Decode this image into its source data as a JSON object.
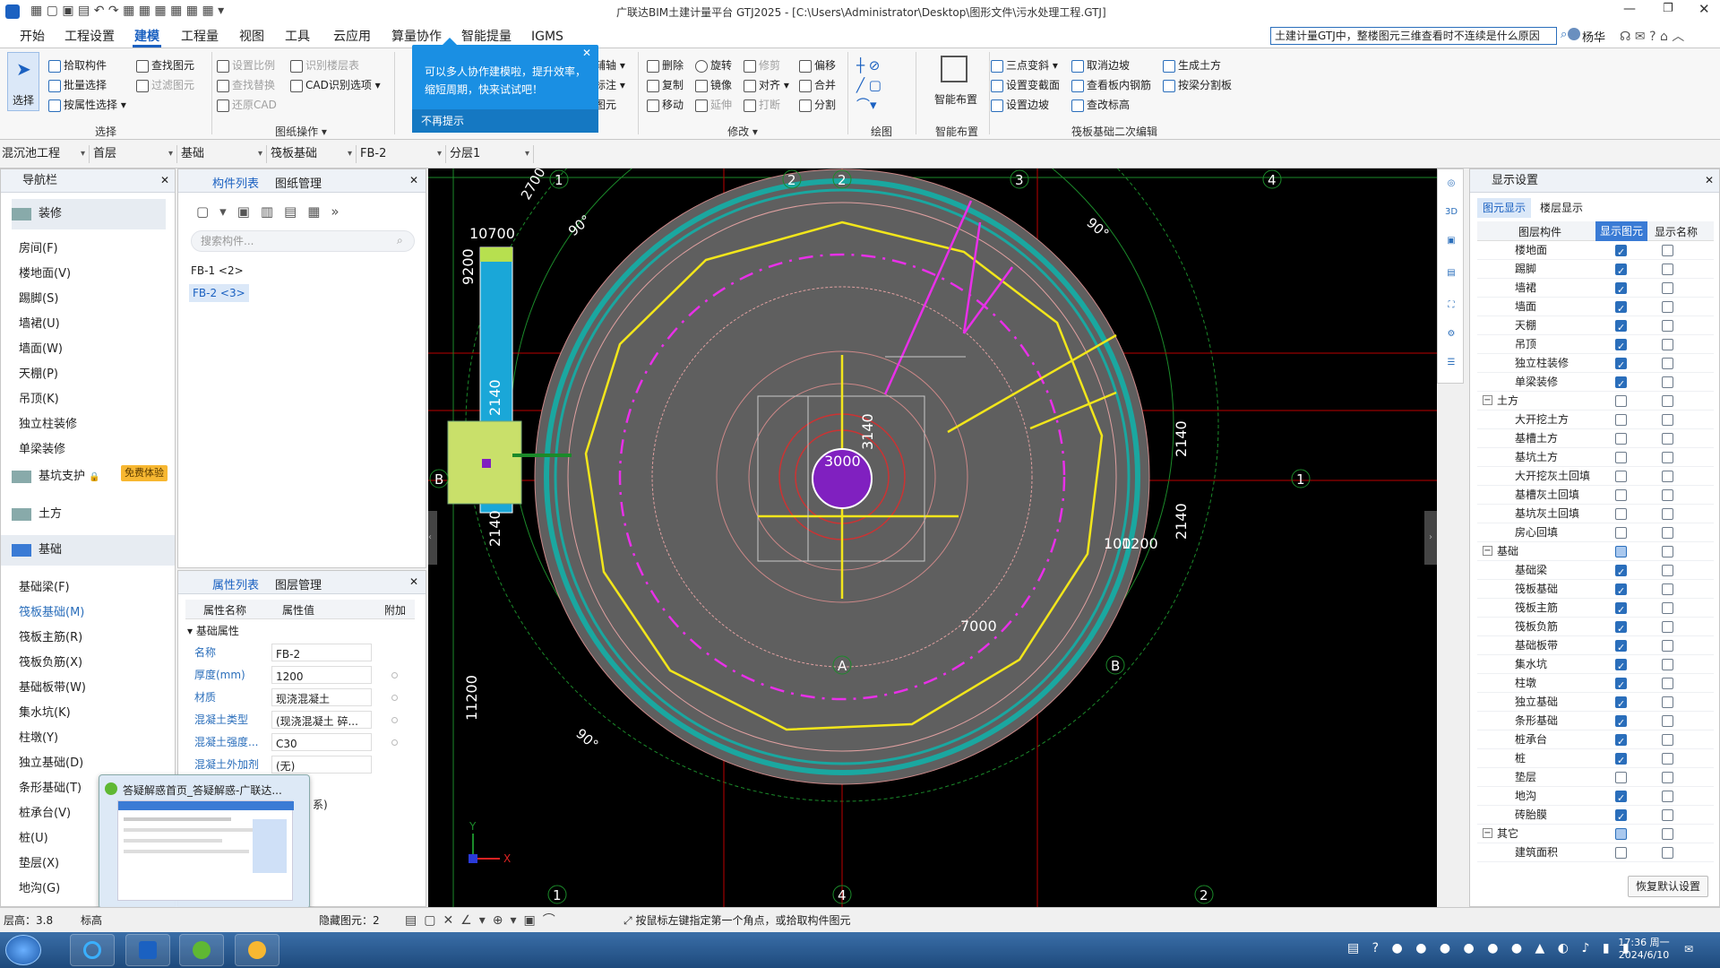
{
  "title": "广联达BIM土建计量平台 GTJ2025 - [C:\\Users\\Administrator\\Desktop\\图形文件\\污水处理工程.GTJ]",
  "menu_tabs": [
    "开始",
    "工程设置",
    "建模",
    "工程量",
    "视图",
    "工具",
    "云应用",
    "算量协作",
    "智能提量",
    "IGMS"
  ],
  "search": {
    "value": "土建计量GTJ中，整楼图元三维查看时不连续是什么原因"
  },
  "user": "杨华",
  "ribbon": {
    "select": {
      "big": "选择",
      "pick": "拾取构件",
      "batch": "批量选择",
      "byattr": "按属性选择",
      "group": "选择"
    },
    "cad": {
      "find": "查找图元",
      "filter": "过滤图元",
      "setscale": "设置比例",
      "findreplace": "查找替换",
      "restore": "还原CAD",
      "recfloor": "识别楼层表",
      "cadopt": "CAD识别选项",
      "group": "图纸操作"
    },
    "modify": {
      "delete": "删除",
      "rotate": "旋转",
      "trim": "修剪",
      "offset": "偏移",
      "copy": "复制",
      "mirror": "镜像",
      "align": "对齐",
      "merge": "合并",
      "move": "移动",
      "extend": "延伸",
      "break": "打断",
      "split": "分割",
      "group": "修改",
      "aux": "辅轴",
      "note": "标注",
      "elem": "图元"
    },
    "draw": {
      "group": "绘图"
    },
    "smart": {
      "big": "智能布置",
      "group": "智能布置"
    },
    "fb": {
      "threeslope": "三点变斜",
      "cancelslope": "取消边坡",
      "genearth": "生成土方",
      "setsection": "设置变截面",
      "viewrebar": "查看板内钢筋",
      "splitbyline": "按梁分割板",
      "setslope": "设置边坡",
      "viewheight": "查改标高",
      "group": "筏板基础二次编辑"
    }
  },
  "tooltip": {
    "text": "可以多人协作建模啦，提升效率，缩短周期，快来试试吧！",
    "dismiss": "不再提示"
  },
  "selectors": [
    "混沉池工程",
    "首层",
    "基础",
    "筏板基础",
    "FB-2",
    "分层1"
  ],
  "nav": {
    "title": "导航栏",
    "cat_decor": "装修",
    "items_decor": [
      "房间(F)",
      "楼地面(V)",
      "踢脚(S)",
      "墙裙(U)",
      "墙面(W)",
      "天棚(P)",
      "吊顶(K)",
      "独立柱装修",
      "单梁装修"
    ],
    "cat_pit": "基坑支护",
    "badge": "免费体验",
    "cat_earth": "土方",
    "cat_found": "基础",
    "items_found": [
      "基础梁(F)",
      "筏板基础(M)",
      "筏板主筋(R)",
      "筏板负筋(X)",
      "基础板带(W)",
      "集水坑(K)",
      "柱墩(Y)",
      "独立基础(D)",
      "条形基础(T)",
      "桩承台(V)",
      "桩(U)",
      "垫层(X)",
      "地沟(G)"
    ]
  },
  "complist": {
    "tab1": "构件列表",
    "tab2": "图纸管理",
    "search_ph": "搜索构件...",
    "items": [
      "FB-1 <2>",
      "FB-2 <3>"
    ]
  },
  "props": {
    "tab1": "属性列表",
    "tab2": "图层管理",
    "col_name": "属性名称",
    "col_value": "属性值",
    "col_add": "附加",
    "section": "基础属性",
    "rows": [
      {
        "k": "名称",
        "v": "FB-2"
      },
      {
        "k": "厚度(mm)",
        "v": "1200"
      },
      {
        "k": "材质",
        "v": "现浇混凝土"
      },
      {
        "k": "混凝土类型",
        "v": "(现浇混凝土  碎..."
      },
      {
        "k": "混凝土强度...",
        "v": "C30"
      },
      {
        "k": "混凝土外加剂",
        "v": "(无)"
      }
    ],
    "partial": "系)"
  },
  "popup": {
    "title": "答疑解惑首页_答疑解惑-广联达..."
  },
  "display": {
    "title": "显示设置",
    "tab1": "图元显示",
    "tab2": "楼层显示",
    "col1": "图层构件",
    "col2": "显示图元",
    "col3": "显示名称",
    "rows": [
      {
        "n": "楼地面",
        "s": "on",
        "sec": false
      },
      {
        "n": "踢脚",
        "s": "on",
        "sec": false
      },
      {
        "n": "墙裙",
        "s": "on",
        "sec": false
      },
      {
        "n": "墙面",
        "s": "on",
        "sec": false
      },
      {
        "n": "天棚",
        "s": "on",
        "sec": false
      },
      {
        "n": "吊顶",
        "s": "on",
        "sec": false
      },
      {
        "n": "独立柱装修",
        "s": "on",
        "sec": false
      },
      {
        "n": "单梁装修",
        "s": "on",
        "sec": false
      },
      {
        "n": "土方",
        "s": "off",
        "sec": true
      },
      {
        "n": "大开挖土方",
        "s": "off",
        "sec": false
      },
      {
        "n": "基槽土方",
        "s": "off",
        "sec": false
      },
      {
        "n": "基坑土方",
        "s": "off",
        "sec": false
      },
      {
        "n": "大开挖灰土回填",
        "s": "off",
        "sec": false
      },
      {
        "n": "基槽灰土回填",
        "s": "off",
        "sec": false
      },
      {
        "n": "基坑灰土回填",
        "s": "off",
        "sec": false
      },
      {
        "n": "房心回填",
        "s": "off",
        "sec": false
      },
      {
        "n": "基础",
        "s": "part",
        "sec": true
      },
      {
        "n": "基础梁",
        "s": "on",
        "sec": false
      },
      {
        "n": "筏板基础",
        "s": "on",
        "sec": false
      },
      {
        "n": "筏板主筋",
        "s": "on",
        "sec": false
      },
      {
        "n": "筏板负筋",
        "s": "on",
        "sec": false
      },
      {
        "n": "基础板带",
        "s": "on",
        "sec": false
      },
      {
        "n": "集水坑",
        "s": "on",
        "sec": false
      },
      {
        "n": "柱墩",
        "s": "on",
        "sec": false
      },
      {
        "n": "独立基础",
        "s": "on",
        "sec": false
      },
      {
        "n": "条形基础",
        "s": "on",
        "sec": false
      },
      {
        "n": "桩承台",
        "s": "on",
        "sec": false
      },
      {
        "n": "桩",
        "s": "on",
        "sec": false
      },
      {
        "n": "垫层",
        "s": "off",
        "sec": false
      },
      {
        "n": "地沟",
        "s": "on",
        "sec": false
      },
      {
        "n": "砖胎膜",
        "s": "on",
        "sec": false
      },
      {
        "n": "其它",
        "s": "part",
        "sec": true
      },
      {
        "n": "建筑面积",
        "s": "off",
        "sec": false
      }
    ],
    "restore": "恢复默认设置"
  },
  "drawing": {
    "labels": [
      "10700",
      "9200",
      "2140",
      "2140",
      "11200",
      "2140",
      "2140",
      "3140",
      "3000",
      "7000",
      "100",
      "1200",
      "90°",
      "90°",
      "90°",
      "90°",
      "2700"
    ],
    "axis_top": [
      "1",
      "2",
      "2",
      "3",
      "4"
    ],
    "axis_bottom": [
      "1",
      "4",
      "2"
    ],
    "axis_mid": [
      "A",
      "B",
      "B",
      "1"
    ]
  },
  "status": {
    "height": "层高：3.8",
    "std": "标高",
    "hidden": "隐藏图元：2",
    "hint": "按鼠标左键指定第一个角点，或拾取构件图元"
  },
  "clock": {
    "time": "17:36 周一",
    "date": "2024/6/10"
  },
  "colors": {
    "canvas": "#000000",
    "plate": "#5f5f5f",
    "ring": "#1aa7a0",
    "rebar": "#f2e61b",
    "magenta": "#e830e8",
    "accent": "#1b61c1"
  }
}
